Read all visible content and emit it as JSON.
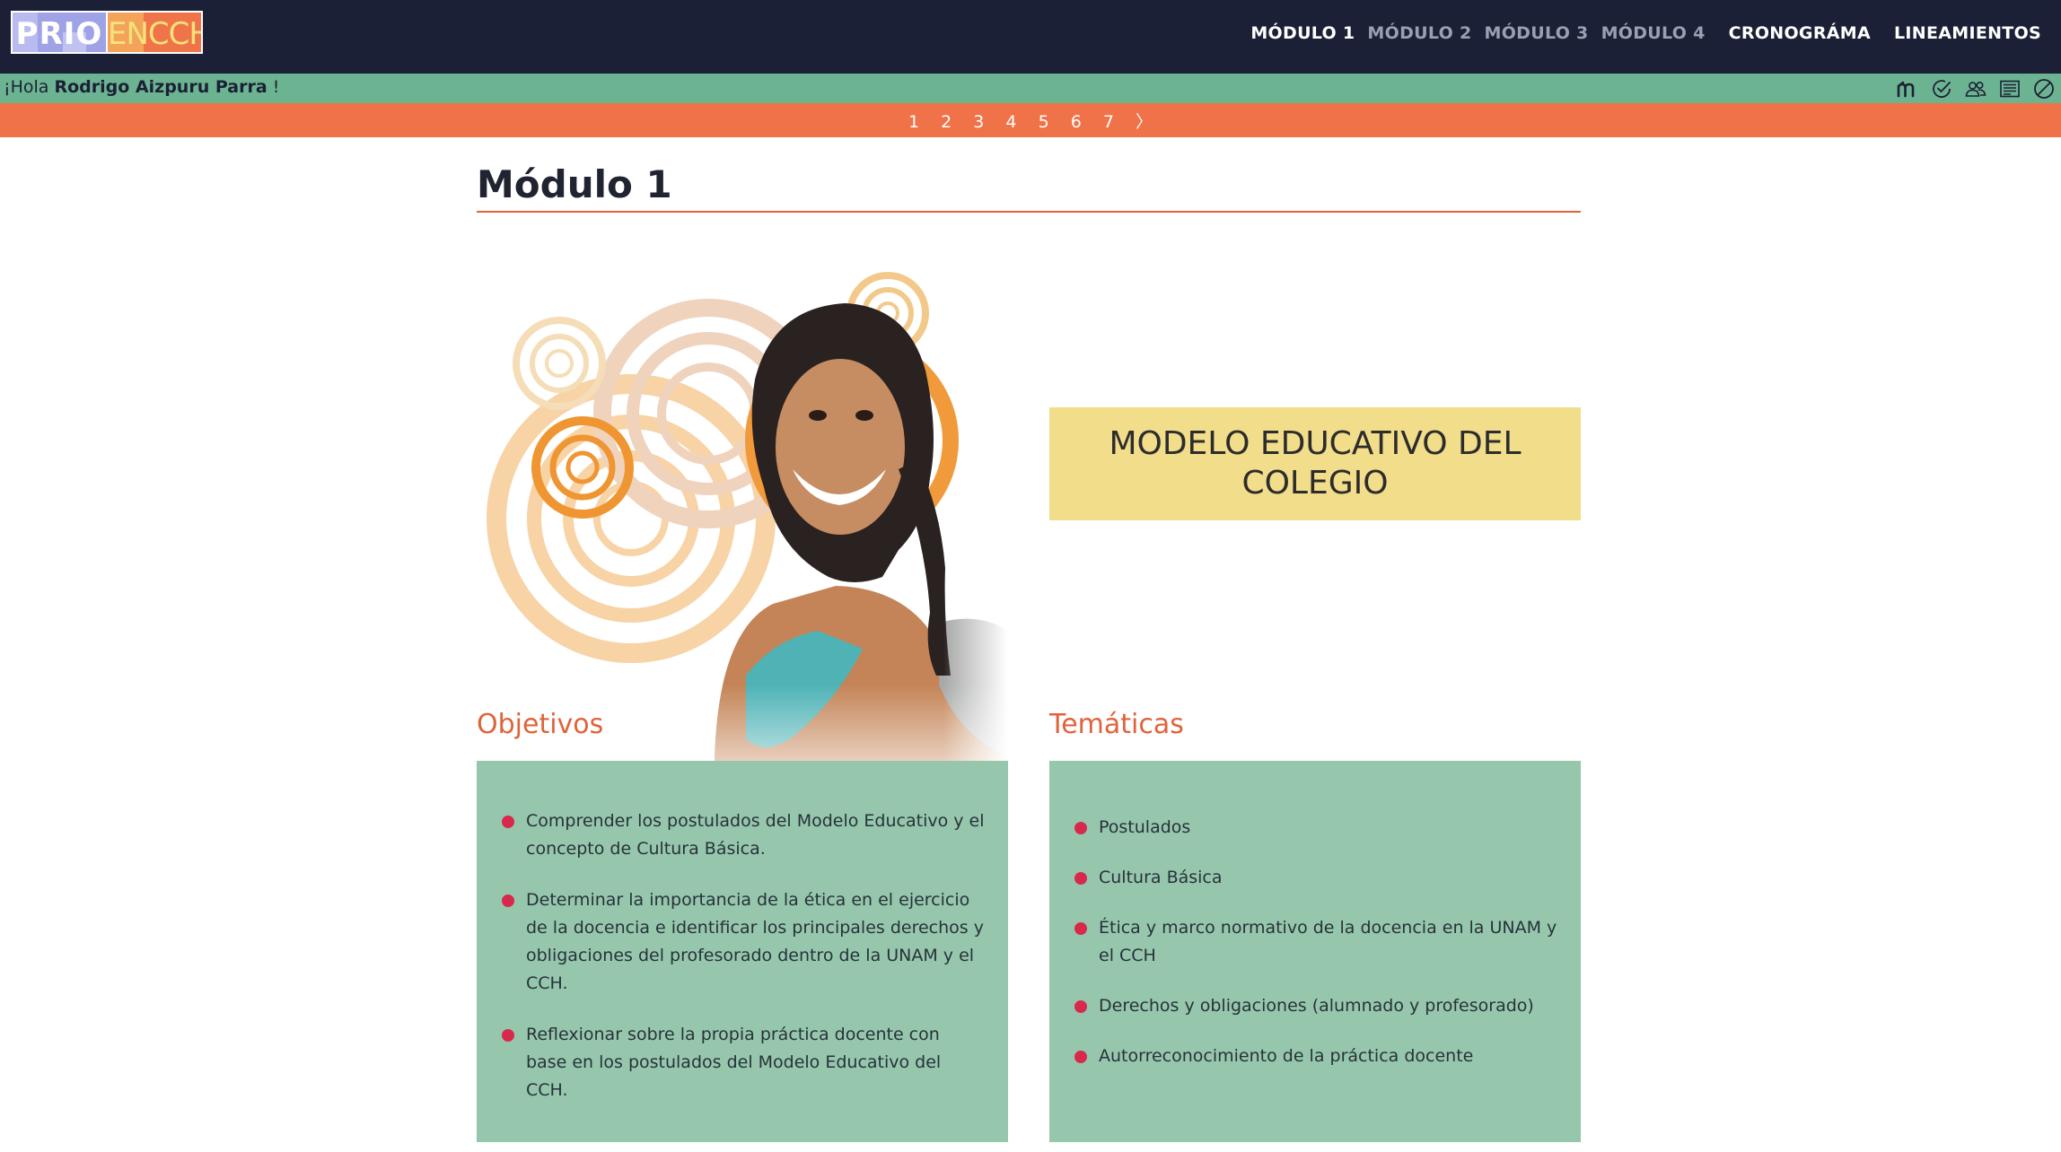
{
  "brand": {
    "logo_left": "PRIO",
    "logo_right": "ENCCH"
  },
  "nav": [
    {
      "label": "MÓDULO 1",
      "state": "active"
    },
    {
      "label": "MÓDULO 2",
      "state": "inactive"
    },
    {
      "label": "MÓDULO 3",
      "state": "inactive"
    },
    {
      "label": "MÓDULO 4",
      "state": "inactive"
    },
    {
      "label": "CRONOGRÁMA",
      "state": "active"
    },
    {
      "label": "LINEAMIENTOS",
      "state": "active"
    }
  ],
  "greeting": {
    "prefix": "¡Hola",
    "name": "Rodrigo Aizpuru Parra",
    "suffix": "!"
  },
  "toolbar_icons": [
    "moodle-icon",
    "check-circle-icon",
    "users-icon",
    "news-icon",
    "disabled-icon"
  ],
  "pager": {
    "pages": [
      "1",
      "2",
      "3",
      "4",
      "5",
      "6",
      "7"
    ],
    "next": "〉"
  },
  "main": {
    "title": "Módulo 1",
    "banner": "MODELO EDUCATIVO DEL COLEGIO",
    "objetivos": {
      "title": "Objetivos",
      "items": [
        "Comprender los postulados del Modelo Educativo y el concepto de Cultura Básica.",
        "Determinar la importancia de la ética en el ejercicio de la docencia e identificar los principales derechos y obligaciones del profesorado dentro de la UNAM y el CCH.",
        "Reflexionar sobre la propia práctica docente con base en los postulados del Modelo Educativo del CCH."
      ]
    },
    "tematicas": {
      "title": "Temáticas",
      "items": [
        "Postulados",
        "Cultura Básica",
        "Ética y marco normativo de la docencia en la UNAM y el CCH",
        "Derechos y obligaciones (alumnado y profesorado)",
        "Autorreconocimiento de la práctica docente"
      ]
    }
  },
  "colors": {
    "nav_bg": "#1b2036",
    "greeting_bg": "#6cb491",
    "pager_bg": "#ef7249",
    "accent": "#e0633a",
    "banner_bg": "#f2dd8a",
    "panel_bg": "#96c7ad",
    "bullet": "#d8294d"
  }
}
